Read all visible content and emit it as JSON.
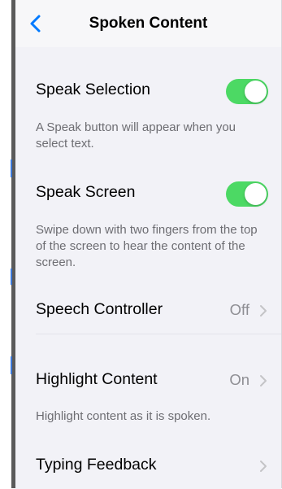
{
  "nav": {
    "title": "Spoken Content",
    "back_icon": "chevron-left-icon",
    "accent": "#007aff"
  },
  "rows": [
    {
      "label": "Speak Selection",
      "toggle_on": true
    },
    {
      "label": "Speak Screen",
      "toggle_on": true
    },
    {
      "label": "Speech Controller",
      "value": "Off"
    },
    {
      "label": "Highlight Content",
      "value": "On"
    },
    {
      "label": "Typing Feedback"
    }
  ],
  "footers": {
    "speak_selection": "A Speak button will appear when you select text.",
    "speak_screen": "Swipe down with two fingers from the top of the screen to hear the content of the screen.",
    "highlight_content": "Highlight content as it is spoken."
  },
  "colors": {
    "toggle_on": "#4cd964",
    "background": "#f2f2f7",
    "secondary_text": "#6d6d72"
  }
}
